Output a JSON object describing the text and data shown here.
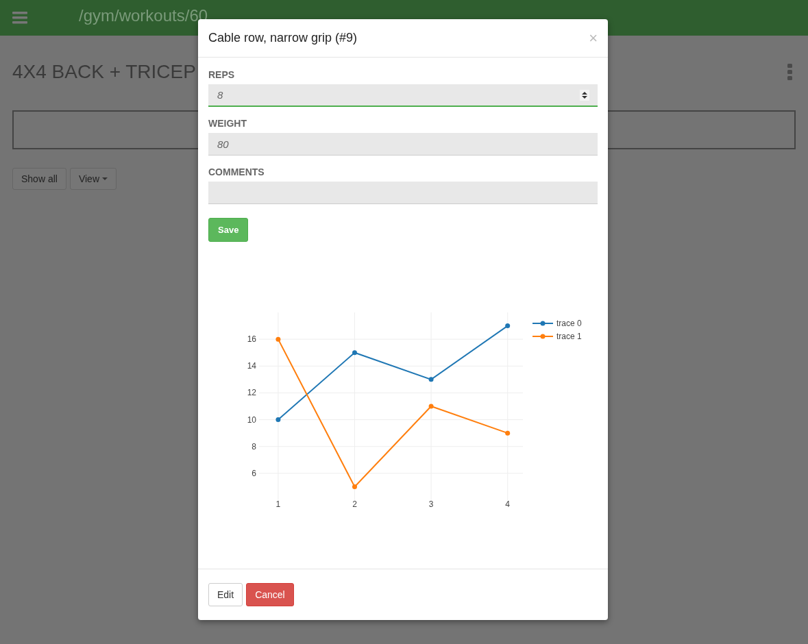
{
  "navbar": {
    "path": "/gym/workouts/60"
  },
  "page": {
    "title": "4X4 BACK + TRICEP",
    "buttons": [
      {
        "label": "Show all",
        "kind": "plain"
      },
      {
        "label": "View",
        "kind": "dropdown"
      }
    ]
  },
  "modal": {
    "title": "Cable row, narrow grip (#9)",
    "close": "×",
    "fields": [
      {
        "label": "REPS",
        "kind": "number",
        "placeholder": "8",
        "focused": true
      },
      {
        "label": "WEIGHT",
        "kind": "text",
        "placeholder": "80",
        "focused": false
      },
      {
        "label": "COMMENTS",
        "kind": "text",
        "focused": false
      }
    ],
    "save_button": "Save",
    "chart_data": {
      "type": "line",
      "grid": true,
      "legend": true,
      "x": [
        1,
        2,
        3,
        4
      ],
      "xlim": [
        0.75,
        4.2
      ],
      "ylim": [
        4,
        18
      ],
      "xticks": [
        1,
        2,
        3,
        4
      ],
      "yticks": [
        6,
        8,
        10,
        12,
        14,
        16
      ],
      "series": [
        {
          "name": "trace 0",
          "color": "#1f77b4",
          "marker": true,
          "values": [
            10,
            15,
            13,
            17
          ]
        },
        {
          "name": "trace 1",
          "color": "#ff7f0e",
          "marker": true,
          "values": [
            16,
            5,
            11,
            9
          ]
        }
      ]
    },
    "footer_buttons": [
      {
        "label": "Edit",
        "kind": "default"
      },
      {
        "label": "Cancel",
        "kind": "danger"
      }
    ]
  }
}
